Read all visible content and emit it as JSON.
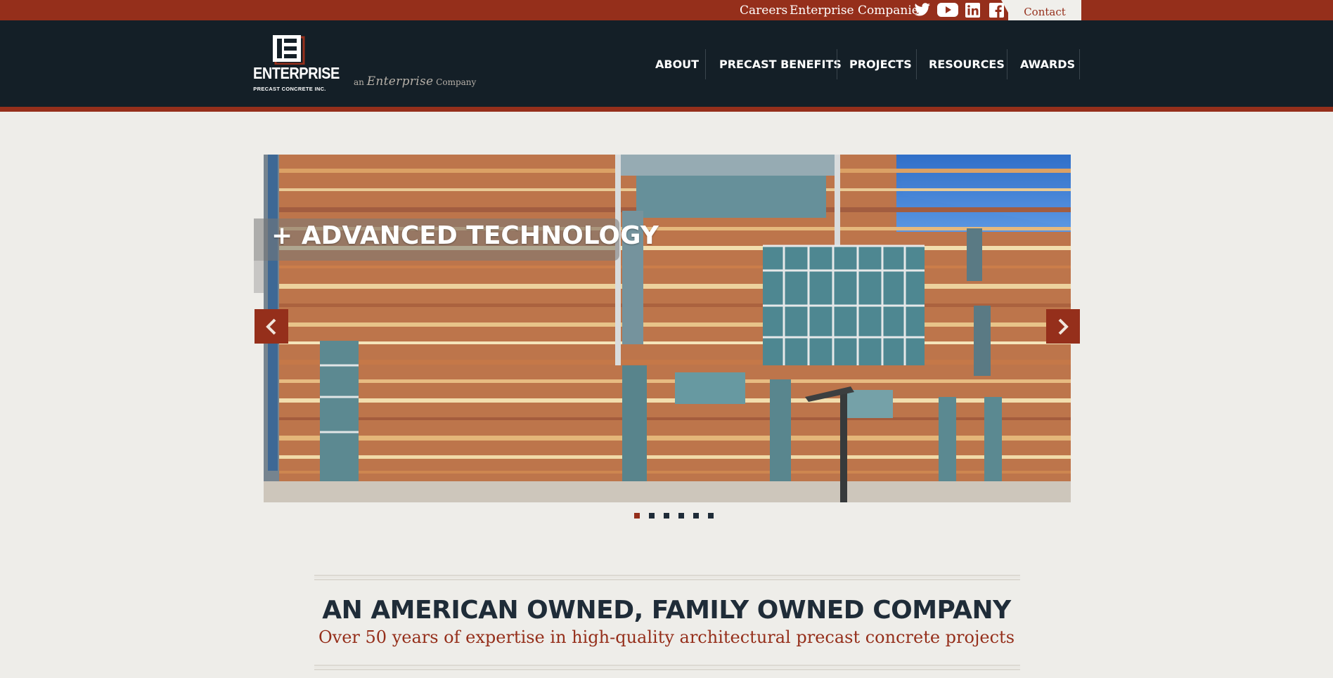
{
  "topbar": {
    "careers_label": "Careers",
    "enterprise_label": "Enterprise Companies",
    "social_icons": [
      "twitter-icon",
      "youtube-icon",
      "linkedin-icon",
      "facebook-icon"
    ],
    "contact_label": "Contact"
  },
  "header": {
    "logo_word": "ENTERPRISE",
    "logo_sub": "PRECAST CONCRETE INC.",
    "tagline_prefix": "an",
    "tagline_script": "Enterprise",
    "tagline_suffix": "Company"
  },
  "nav": {
    "items": [
      {
        "label": "ABOUT"
      },
      {
        "label": "PRECAST BENEFITS"
      },
      {
        "label": "PROJECTS"
      },
      {
        "label": "RESOURCES"
      },
      {
        "label": "AWARDS"
      }
    ]
  },
  "slider": {
    "caption": "+ ADVANCED TECHNOLOGY",
    "prev_icon": "chevron-left-icon",
    "next_icon": "chevron-right-icon",
    "slide_count": 6,
    "active_slide": 1
  },
  "intro": {
    "headline": "AN AMERICAN OWNED, FAMILY OWNED COMPANY",
    "subline": "Over 50 years of expertise in high-quality architectural precast concrete projects"
  },
  "colors": {
    "brand_red": "#952f1b",
    "header_dark": "#141f27",
    "page_bg": "#eeede9",
    "headline_navy": "#1f2c38"
  }
}
